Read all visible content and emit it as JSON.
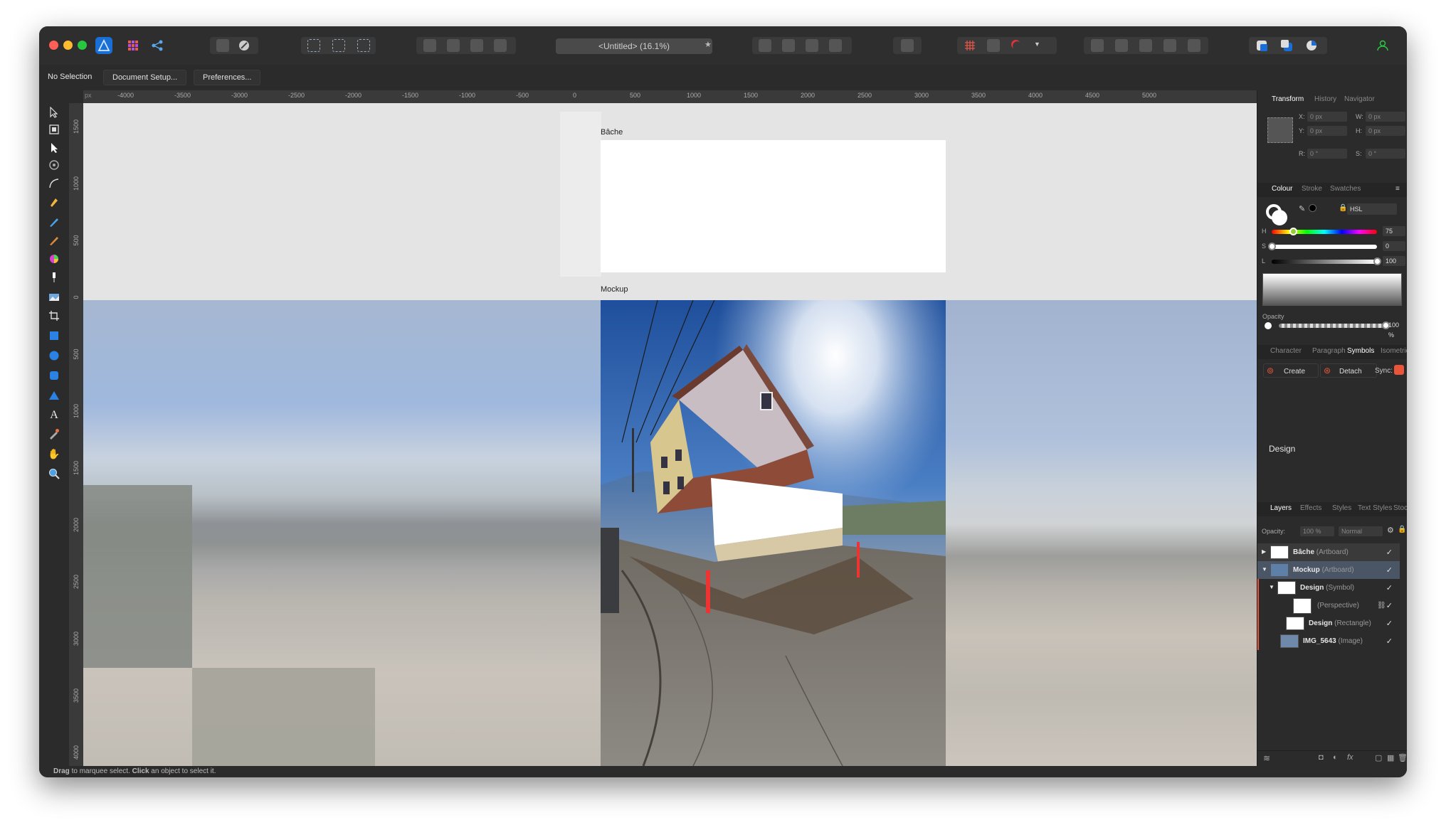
{
  "window": {
    "title": "<Untitled> (16.1%)"
  },
  "context": {
    "selection": "No Selection",
    "doc_setup": "Document Setup...",
    "preferences": "Preferences..."
  },
  "ruler_h": [
    "-4000",
    "-3500",
    "-3000",
    "-2500",
    "-2000",
    "-1500",
    "-1000",
    "-500",
    "0",
    "500",
    "1000",
    "1500",
    "2000",
    "2500",
    "3000",
    "3500",
    "4000",
    "4500",
    "5000"
  ],
  "ruler_v": [
    "1500",
    "1000",
    "500",
    "0",
    "500",
    "1000",
    "1500",
    "2000",
    "2500",
    "3000",
    "3500",
    "4000"
  ],
  "artboards": {
    "bache": "Bâche",
    "mockup": "Mockup"
  },
  "transform": {
    "tabs": [
      "Transform",
      "History",
      "Navigator"
    ],
    "x_label": "X:",
    "x": "0 px",
    "y_label": "Y:",
    "y": "0 px",
    "w_label": "W:",
    "w": "0 px",
    "h_label": "H:",
    "h": "0 px",
    "r_label": "R:",
    "r": "0 °",
    "s_label": "S:",
    "s": "0 °"
  },
  "colour": {
    "tabs": [
      "Colour",
      "Stroke",
      "Swatches"
    ],
    "model": "HSL",
    "h_label": "H",
    "h": "75",
    "h_pos": 0.2,
    "s_label": "S",
    "s": "0",
    "s_pos": 0.0,
    "l_label": "L",
    "l": "100",
    "l_pos": 1.0,
    "opacity_label": "Opacity",
    "opacity": "100 %",
    "opacity_pos": 1.0
  },
  "symbols": {
    "tabs": [
      "Character",
      "Paragraph",
      "Symbols",
      "Isometric"
    ],
    "create": "Create",
    "detach": "Detach",
    "sync": "Sync:",
    "item": "Design"
  },
  "layers": {
    "tabs": [
      "Layers",
      "Effects",
      "Styles",
      "Text Styles",
      "Stock"
    ],
    "opacity_label": "Opacity:",
    "opacity": "100 %",
    "blend": "Normal",
    "items": [
      {
        "name": "Bâche",
        "type": "(Artboard)"
      },
      {
        "name": "Mockup",
        "type": "(Artboard)"
      },
      {
        "name": "Design",
        "type": "(Symbol)"
      },
      {
        "name": "",
        "type": "(Perspective)"
      },
      {
        "name": "Design",
        "type": "(Rectangle)"
      },
      {
        "name": "IMG_5643",
        "type": "(Image)"
      }
    ]
  },
  "status": {
    "drag": "Drag",
    "drag_text": " to marquee select. ",
    "click": "Click",
    "click_text": " an object to select it."
  },
  "colors": {
    "accent": "#0b84ff",
    "selected_row": "#4a5566",
    "panel": "#2b2b2b"
  }
}
